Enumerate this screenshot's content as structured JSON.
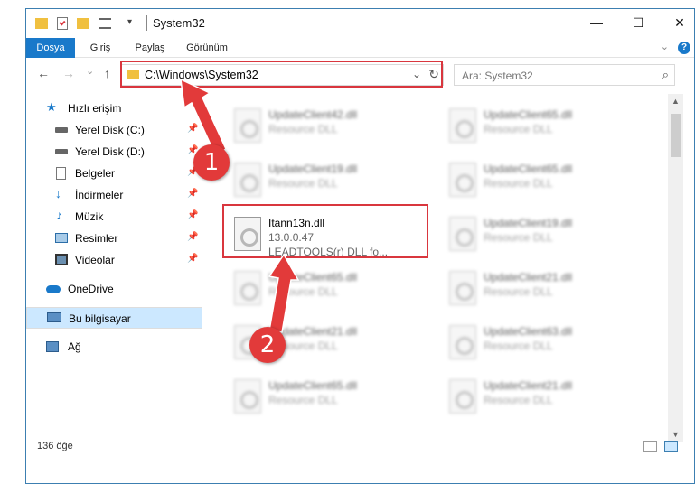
{
  "window": {
    "title": "System32",
    "minimize_glyph": "—",
    "maximize_glyph": "☐",
    "close_glyph": "✕"
  },
  "ribbon": {
    "tabs": [
      {
        "label": "Dosya"
      },
      {
        "label": "Giriş"
      },
      {
        "label": "Paylaş"
      },
      {
        "label": "Görünüm"
      }
    ],
    "help_glyph": "?",
    "collapse_glyph": "⌄"
  },
  "nav": {
    "back_glyph": "←",
    "forward_glyph": "→",
    "recent_glyph": "⌄",
    "up_glyph": "↑",
    "address": "C:\\Windows\\System32",
    "address_dropdown_glyph": "⌄",
    "refresh_glyph": "↻",
    "search_placeholder": "Ara: System32",
    "search_glyph": "⌕"
  },
  "sidebar": {
    "items": [
      {
        "label": "Hızlı erişim",
        "icon": "star-icon"
      },
      {
        "label": "Yerel Disk (C:)",
        "icon": "drive-icon",
        "pinned": true
      },
      {
        "label": "Yerel Disk (D:)",
        "icon": "drive-icon",
        "pinned": true
      },
      {
        "label": "Belgeler",
        "icon": "documents-icon",
        "pinned": true
      },
      {
        "label": "İndirmeler",
        "icon": "download-icon",
        "pinned": true
      },
      {
        "label": "Müzik",
        "icon": "music-icon",
        "pinned": true
      },
      {
        "label": "Resimler",
        "icon": "pictures-icon",
        "pinned": true
      },
      {
        "label": "Videolar",
        "icon": "video-icon",
        "pinned": true
      },
      {
        "label": "OneDrive",
        "icon": "cloud-icon"
      },
      {
        "label": "Bu bilgisayar",
        "icon": "computer-icon",
        "selected": true
      },
      {
        "label": "Ağ",
        "icon": "network-icon"
      }
    ]
  },
  "files": {
    "left_column": [
      {
        "name": "UpdateClient42.dll",
        "type": "Resource DLL"
      },
      {
        "name": "UpdateClient19.dll",
        "type": "Resource DLL"
      },
      {
        "name": "UpdateClient65.dll",
        "type": "Resource DLL"
      },
      {
        "name": "UpdateClient21.dll",
        "type": "Resource DLL"
      },
      {
        "name": "UpdateClient65.dll",
        "type": "Resource DLL"
      }
    ],
    "right_column": [
      {
        "name": "UpdateClient65.dll",
        "type": "Resource DLL"
      },
      {
        "name": "UpdateClient65.dll",
        "type": "Resource DLL"
      },
      {
        "name": "UpdateClient19.dll",
        "type": "Resource DLL"
      },
      {
        "name": "UpdateClient21.dll",
        "type": "Resource DLL"
      },
      {
        "name": "UpdateClient63.dll",
        "type": "Resource DLL"
      },
      {
        "name": "UpdateClient21.dll",
        "type": "Resource DLL"
      }
    ],
    "highlighted": {
      "name": "Itann13n.dll",
      "version": "13.0.0.47",
      "description": "LEADTOOLS(r) DLL fo..."
    }
  },
  "scrollbar": {
    "up_glyph": "▲",
    "down_glyph": "▼"
  },
  "status": {
    "item_count": "136 öğe"
  },
  "markers": [
    "1",
    "2"
  ],
  "colors": {
    "accent": "#1979ca",
    "annotation_red": "#d9363e",
    "selected_bg": "#cce8ff"
  }
}
